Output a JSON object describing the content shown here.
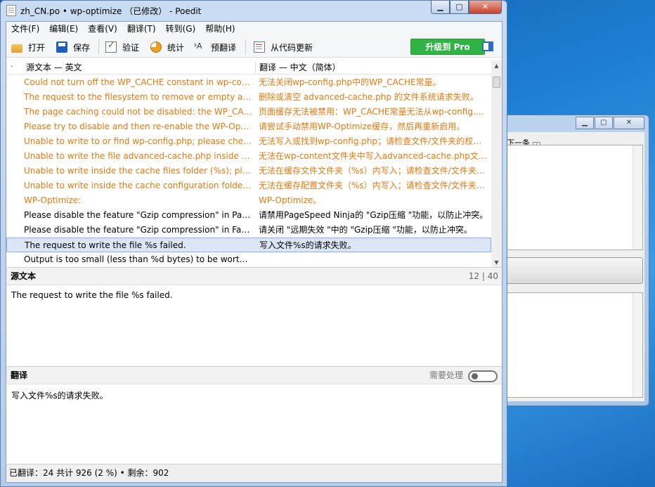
{
  "window": {
    "title": "zh_CN.po • wp-optimize （已修改） - Poedit",
    "minimize": "▁",
    "maximize": "▢",
    "close": "✕"
  },
  "background_window": {
    "next_label": "下一条"
  },
  "menu": [
    "文件(F)",
    "编辑(E)",
    "查看(V)",
    "翻译(T)",
    "转到(G)",
    "帮助(H)"
  ],
  "toolbar": {
    "open": "打开",
    "save": "保存",
    "validate": "验证",
    "stats": "统计",
    "pretranslate": "预翻译",
    "update_from_code": "从代码更新",
    "upgrade": "升级到 Pro"
  },
  "list": {
    "header_marker": "·",
    "col_source": "源文本 — 英文",
    "col_translation": "翻译 — 中文（简体）",
    "rows": [
      {
        "src": "Could not turn off the WP_CACHE constant in wp-config.php.",
        "tr": "无法关闭wp-config.php中的WP_CACHE常量。"
      },
      {
        "src": "The request to the filesystem to remove or empty advanced-cache.php failed.",
        "tr": "删除或清空 advanced-cache.php 的文件系统请求失败。"
      },
      {
        "src": "The page caching could not be disabled: the WP_CACHE constant could not be removed",
        "tr": "页面缓存无法被禁用：WP_CACHE常量无法从wp-config.php中删除"
      },
      {
        "src": "Please try to disable and then re-enable the WP-Optimize cache.",
        "tr": "请尝试手动禁用WP-Optimize缓存，然后再重新启用。"
      },
      {
        "src": "Unable to write to or find wp-config.php; please check file/folder permissions.",
        "tr": "无法写入或找到wp-config.php；请检查文件/文件夹的权限。"
      },
      {
        "src": "Unable to write the file advanced-cache.php inside the wp-content folder.",
        "tr": "无法在wp-content文件夹中写入advanced-cache.php文件。"
      },
      {
        "src": "Unable to write inside the cache files folder (%s); please check permissions.",
        "tr": "无法在缓存文件文件夹（%s）内写入；请检查文件/文件夹权限。"
      },
      {
        "src": "Unable to write inside the cache configuration folder (%s); please check permissions.",
        "tr": "无法在缓存配置文件夹（%s）内写入；请检查文件/文件夹权限。"
      },
      {
        "src": "WP-Optimize:",
        "tr": "WP-Optimize。"
      },
      {
        "src": "Please disable the feature \"Gzip compression\" in PageSpeed Ninja to prevent conflicts.",
        "tr": "请禁用PageSpeed Ninja的 \"Gzip压缩 \"功能，以防止冲突。"
      },
      {
        "src": "Please disable the feature \"Gzip compression\" in Far Future Expiry to prevent conflicts.",
        "tr": "请关闭 \"远期失效 \"中的 \"Gzip压缩 \"功能，以防止冲突。"
      },
      {
        "src": "The request to write the file %s failed.",
        "tr": "写入文件%s的请求失败。"
      },
      {
        "src": "Output is too small (less than %d bytes) to be worth caching.",
        "tr": ""
      }
    ]
  },
  "source_section": {
    "label": "源文本",
    "count": "12 | 40",
    "text": "The request to write the file %s failed."
  },
  "translation_section": {
    "label": "翻译",
    "needs_work": "需要处理",
    "text": "写入文件%s的请求失败。"
  },
  "status": "已翻译：24 共计 926 (2 %)  •  剩余：902"
}
